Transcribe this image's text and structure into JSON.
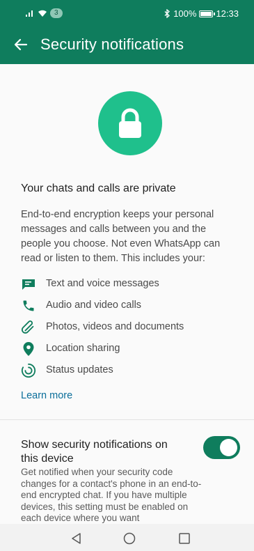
{
  "status_bar": {
    "badge": "3",
    "battery": "100%",
    "time": "12:33"
  },
  "header": {
    "title": "Security notifications"
  },
  "privacy": {
    "title": "Your chats and calls are private",
    "description": "End-to-end encryption keeps your personal messages and calls between you and the people you choose. Not even WhatsApp can read or listen to them. This includes your:",
    "features": [
      {
        "label": "Text and voice messages",
        "icon": "message-icon"
      },
      {
        "label": "Audio and video calls",
        "icon": "phone-icon"
      },
      {
        "label": "Photos, videos and documents",
        "icon": "paperclip-icon"
      },
      {
        "label": "Location sharing",
        "icon": "location-pin-icon"
      },
      {
        "label": "Status updates",
        "icon": "status-icon"
      }
    ],
    "learn_more": "Learn more"
  },
  "setting": {
    "title": "Show security notifications on this device",
    "description": "Get notified when your security code changes for a contact's phone in an end-to-end encrypted chat. If you have multiple devices, this setting must be enabled on each device where you want",
    "enabled": true
  },
  "colors": {
    "header": "#0f7d5d",
    "accent": "#1fc08c",
    "link": "#0b6e9a"
  }
}
